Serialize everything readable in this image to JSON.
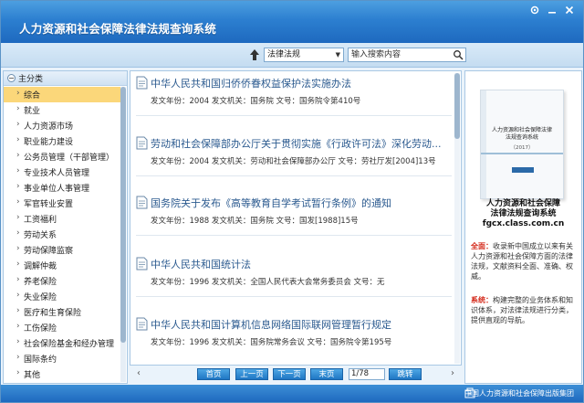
{
  "window": {
    "title": "人力资源和社会保障法律法规查询系统",
    "controls": [
      "settings",
      "minimize",
      "close"
    ]
  },
  "toolbar": {
    "category_select": "法律法规",
    "search_placeholder": "输入搜索内容"
  },
  "sidebar": {
    "root_label": "主分类",
    "items": [
      {
        "label": "综合",
        "active": true
      },
      {
        "label": "就业"
      },
      {
        "label": "人力资源市场"
      },
      {
        "label": "职业能力建设"
      },
      {
        "label": "公务员管理（干部管理）"
      },
      {
        "label": "专业技术人员管理"
      },
      {
        "label": "事业单位人事管理"
      },
      {
        "label": "军官转业安置"
      },
      {
        "label": "工资福利"
      },
      {
        "label": "劳动关系"
      },
      {
        "label": "劳动保障监察"
      },
      {
        "label": "调解仲裁"
      },
      {
        "label": "养老保险"
      },
      {
        "label": "失业保险"
      },
      {
        "label": "医疗和生育保险"
      },
      {
        "label": "工伤保险"
      },
      {
        "label": "社会保险基金和经办管理"
      },
      {
        "label": "国际条约"
      },
      {
        "label": "其他"
      }
    ]
  },
  "results": [
    {
      "title": "中华人民共和国归侨侨眷权益保护法实施办法",
      "meta": "发文年份：2004 发文机关：国务院 文号：国务院令第410号"
    },
    {
      "title": "劳动和社会保障部办公厅关于贯彻实施《行政许可法》深化劳动...",
      "meta": "发文年份：2004 发文机关：劳动和社会保障部办公厅 文号：劳社厅发[2004]13号"
    },
    {
      "title": "国务院关于发布《高等教育自学考试暂行条例》的通知",
      "meta": "发文年份：1988 发文机关：国务院 文号：国发[1988]15号"
    },
    {
      "title": "中华人民共和国统计法",
      "meta": "发文年份：1996 发文机关：全国人民代表大会常务委员会 文号：无"
    },
    {
      "title": "中华人民共和国计算机信息网络国际联网管理暂行规定",
      "meta": "发文年份：1996 发文机关：国务院常务会议 文号：国务院令第195号"
    }
  ],
  "pager": {
    "first": "首页",
    "prev": "上一页",
    "next": "下一页",
    "last": "末页",
    "page_value": "1/78",
    "jump": "跳转"
  },
  "right_panel": {
    "book_title": "人力资源和社会保障法律法规查询系统",
    "book_year": "（2017）",
    "name_line1": "人力资源和社会保障",
    "name_line2": "法律法规查询系统",
    "url": "fgcx.class.com.cn",
    "para1_label": "全面：",
    "para1_text": "收录新中国成立以来有关人力资源和社会保障方面的法律法规，文献资料全面、准确、权威。",
    "para2_label": "系统：",
    "para2_text": "构建完整的业务体系和知识体系，对法律法规进行分类，提供直观的导航。"
  },
  "status": {
    "publisher": "中国人力资源和社会保障出版集团"
  },
  "colors": {
    "title_bar": "#2c7fd0",
    "active_item": "#fbd77a",
    "result_title": "#2b5a8f",
    "label_red": "#d42b1c",
    "button_blue": "#1f77c4"
  }
}
